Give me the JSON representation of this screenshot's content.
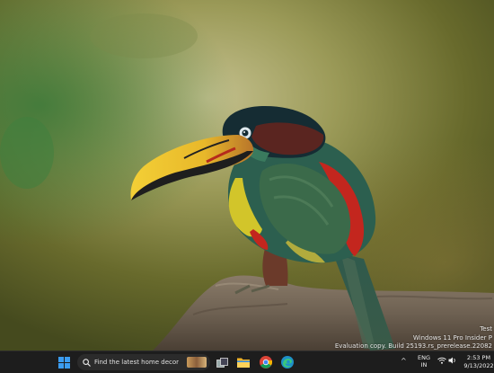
{
  "watermark": {
    "line1": "Test",
    "line2": "Windows 11 Pro Insider P",
    "line3": "Evaluation copy. Build 25193.rs_prerelease.22082"
  },
  "taskbar": {
    "search_text": "Find the latest home decor",
    "icons": [
      "windows-start-icon",
      "search-icon",
      "task-view-icon",
      "file-explorer-icon",
      "chrome-icon",
      "edge-icon"
    ]
  },
  "tray": {
    "chevron": "^",
    "lang_line1": "ENG",
    "lang_line2": "IN",
    "time": "2:53 PM",
    "date": "9/13/2022"
  },
  "colors": {
    "taskbar_bg": "#1d1d1d",
    "accent_start": "#3b9cf0"
  }
}
